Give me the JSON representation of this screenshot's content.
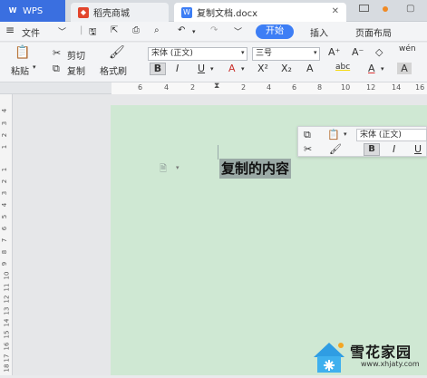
{
  "tabs": {
    "wps_label": "WPS",
    "shop_label": "稻壳商城",
    "doc_label": "复制文档.docx"
  },
  "menu": {
    "file": "文件",
    "start": "开始",
    "insert": "插入",
    "layout": "页面布局"
  },
  "ribbon": {
    "paste": "粘贴",
    "cut": "剪切",
    "copy": "复制",
    "format_painter": "格式刷",
    "font": "宋体 (正文)",
    "size": "三号",
    "bold": "B",
    "italic": "I",
    "underline": "U",
    "font_color": "A",
    "superscript": "X²",
    "subscript": "X₂",
    "text_effect": "A",
    "highlight": "abc",
    "char_shading": "A",
    "grow_font": "A⁺",
    "shrink_font": "A⁻",
    "clear_format": "◇",
    "phonetic": "wén"
  },
  "ruler": {
    "h_ticks": [
      "6",
      "4",
      "2",
      "2",
      "4",
      "6",
      "8",
      "10",
      "12",
      "14",
      "16"
    ],
    "v_ticks": [
      "4",
      "3",
      "2",
      "1",
      "1",
      "2",
      "3",
      "4",
      "5",
      "6",
      "7",
      "8",
      "9",
      "10",
      "11",
      "12",
      "13",
      "14",
      "15",
      "16",
      "17",
      "18"
    ]
  },
  "mini_toolbar": {
    "font": "宋体 (正文)",
    "bold": "B",
    "italic": "I",
    "underline": "U"
  },
  "document": {
    "selected_text": "复制的内容"
  },
  "watermark": {
    "title": "雪花家园",
    "url": "www.xhjaty.com"
  },
  "colors": {
    "accent": "#3d7ef5",
    "wps_tab": "#3a6fe0",
    "page_bg": "#cfe8d3",
    "selection": "#9aa9a5"
  }
}
